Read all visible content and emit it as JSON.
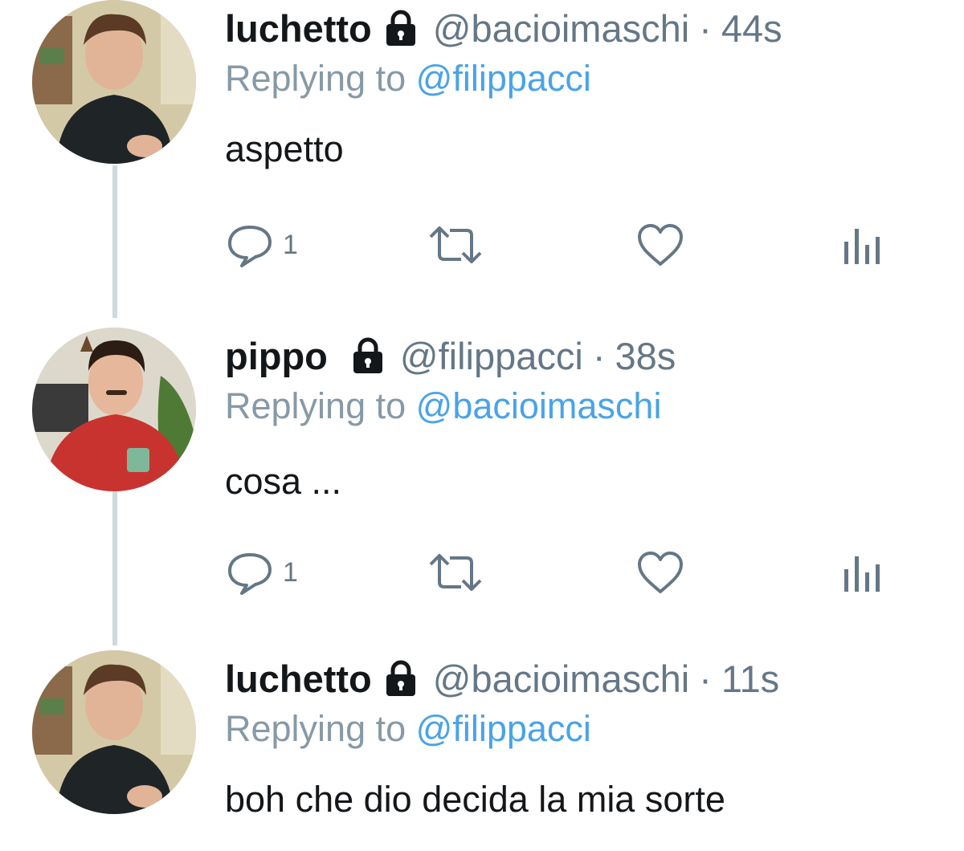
{
  "tweets": [
    {
      "display_name": "luchetto",
      "handle": "@bacioimaschi",
      "separator": "·",
      "time": "44s",
      "replying_prefix": "Replying to",
      "replying_to": "@filippacci",
      "text": "aspetto",
      "reply_count": "1",
      "avatar_shirt_color": "#1f2427",
      "avatar_background_color": "#d4c9a6"
    },
    {
      "display_name": "pippo",
      "handle": "@filippacci",
      "separator": "·",
      "time": "38s",
      "replying_prefix": "Replying to",
      "replying_to": "@bacioimaschi",
      "text": "cosa ...",
      "reply_count": "1",
      "avatar_shirt_color": "#c8332f",
      "avatar_background_color": "#ddd8cc"
    },
    {
      "display_name": "luchetto",
      "handle": "@bacioimaschi",
      "separator": "·",
      "time": "11s",
      "replying_prefix": "Replying to",
      "replying_to": "@filippacci",
      "text": "boh che dio decida la mia sorte",
      "avatar_shirt_color": "#1f2427",
      "avatar_background_color": "#d4c9a6"
    }
  ],
  "colors": {
    "link": "#4aa3e8",
    "muted": "#657786",
    "thread_line": "#cfd9de",
    "icon": "#657786"
  },
  "icons": {
    "lock": "lock-icon",
    "reply": "reply-icon",
    "retweet": "retweet-icon",
    "like": "heart-icon",
    "analytics": "analytics-icon"
  }
}
